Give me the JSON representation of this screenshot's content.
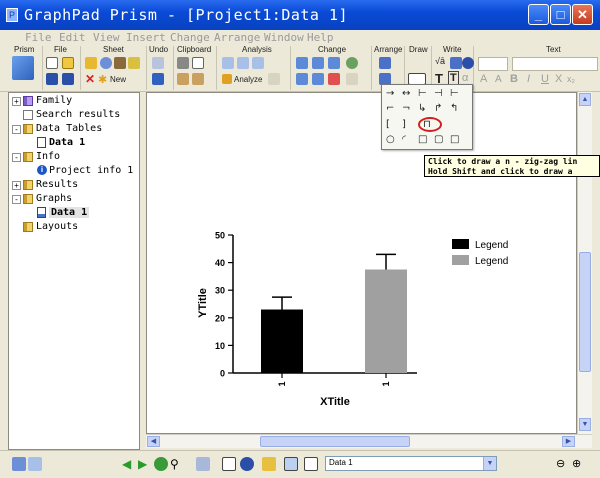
{
  "window": {
    "title": "GraphPad Prism - [Project1:Data 1]",
    "minimize": "_",
    "maximize": "□",
    "close": "✕"
  },
  "menu": [
    "File",
    "Edit",
    "View",
    "Insert",
    "Change",
    "Arrange",
    "Window",
    "Help"
  ],
  "ribbon": {
    "groups": [
      "Prism",
      "File",
      "Sheet",
      "Undo",
      "Clipboard",
      "Analysis",
      "Change",
      "Arrange",
      "Draw",
      "Write",
      "Text"
    ],
    "new_label": "New",
    "analyze_label": "Analyze",
    "text_buttons": [
      "A",
      "A",
      "B",
      "I",
      "U",
      "X",
      "x₂"
    ]
  },
  "navigator": {
    "items": [
      {
        "label": "Family",
        "expander": "+"
      },
      {
        "label": "Search results"
      },
      {
        "label": "Data Tables",
        "expander": "-"
      },
      {
        "label": "Data 1"
      },
      {
        "label": "Info",
        "expander": "-"
      },
      {
        "label": "Project info 1"
      },
      {
        "label": "Results",
        "expander": "+"
      },
      {
        "label": "Graphs",
        "expander": "-"
      },
      {
        "label": "Data 1"
      },
      {
        "label": "Layouts"
      }
    ]
  },
  "tooltip": {
    "line1": "Click to draw a n - zig-zag lin",
    "line2": "Hold Shift and click to draw a"
  },
  "statusbar": {
    "sheet_value": "Data 1"
  },
  "colors": {
    "series1": "#000000",
    "series2": "#a0a0a0"
  },
  "chart_data": {
    "type": "bar",
    "categories": [
      "1",
      "1"
    ],
    "values": [
      23,
      37.5
    ],
    "errors": [
      4.5,
      5.5
    ],
    "bar_colors": [
      "#000000",
      "#a0a0a0"
    ],
    "xlabel": "XTitle",
    "ylabel": "YTitle",
    "ylim": [
      0,
      50
    ],
    "yticks": [
      0,
      10,
      20,
      30,
      40,
      50
    ],
    "legend": [
      "Legend",
      "Legend"
    ],
    "legend_position": "top-right",
    "grid": false
  }
}
